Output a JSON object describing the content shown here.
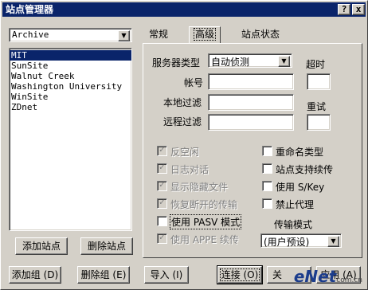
{
  "window": {
    "title": "站点管理器",
    "help_btn": "?",
    "close_btn": "x"
  },
  "left": {
    "group_combo": {
      "value": "Archive",
      "arrow": "▼"
    },
    "sites": [
      "MIT",
      "SunSite",
      "Walnut Creek",
      "Washington University",
      "WinSite",
      "ZDnet"
    ],
    "selected_index": 0,
    "add_site": "添加站点",
    "delete_site": "删除站点"
  },
  "tabs": [
    {
      "label": "常规",
      "active": false
    },
    {
      "label": "高级",
      "active": true
    },
    {
      "label": "站点状态",
      "active": false
    }
  ],
  "advanced": {
    "server_type_label": "服务器类型",
    "server_type_value": "自动侦测",
    "server_type_arrow": "▼",
    "timeout_label": "超时",
    "account_label": "帐号",
    "local_filter_label": "本地过滤",
    "retry_label": "重试",
    "remote_filter_label": "远程过滤",
    "left_checks": [
      {
        "label": "反空闲",
        "checked": true,
        "enabled": false
      },
      {
        "label": "日志对话",
        "checked": true,
        "enabled": false
      },
      {
        "label": "显示隐藏文件",
        "checked": true,
        "enabled": false
      },
      {
        "label": "恢复断开的传输",
        "checked": true,
        "enabled": false
      },
      {
        "label": "使用 PASV 模式",
        "checked": false,
        "enabled": true
      },
      {
        "label": "使用 APPE 续传",
        "checked": true,
        "enabled": false
      }
    ],
    "right_checks": [
      {
        "label": "重命名类型",
        "checked": false
      },
      {
        "label": "站点支持续传",
        "checked": false
      },
      {
        "label": "使用 S/Key",
        "checked": false
      },
      {
        "label": "禁止代理",
        "checked": false
      }
    ],
    "transfer_mode_label": "传输模式",
    "transfer_mode_value": "(用户预设)",
    "transfer_mode_arrow": "▼"
  },
  "bottom": {
    "add_group": "添加组 (D)",
    "delete_group": "删除组 (E)",
    "import": "导入 (I)",
    "connect": "连接 (O)",
    "close_partial": "关",
    "apply": "应用 (A)"
  },
  "watermark": {
    "text": "eNet",
    "sub": "com.cn"
  }
}
